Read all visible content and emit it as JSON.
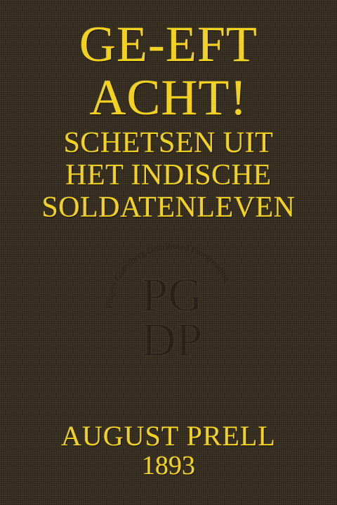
{
  "cover": {
    "title": [
      "GE-EFT",
      "ACHT!"
    ],
    "subtitle": [
      "SCHETSEN UIT",
      "HET INDISCHE",
      "SOLDATENLEVEN"
    ],
    "author": "AUGUST PRELL",
    "year": "1893",
    "text_color": "#f2d21e",
    "background_color": "#372e20"
  },
  "seal": {
    "letters": [
      "PG",
      "DP"
    ],
    "ring_text": "Project Gutenberg Distributed Proofreading"
  }
}
